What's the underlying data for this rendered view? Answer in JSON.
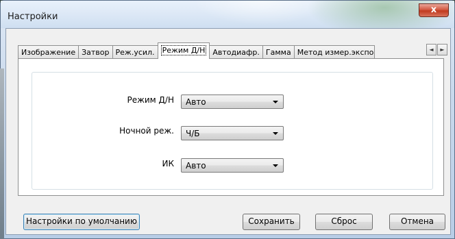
{
  "window": {
    "title": "Настройки",
    "close_symbol": "x"
  },
  "tabs": [
    {
      "label": "Изображение",
      "active": false
    },
    {
      "label": "Затвор",
      "active": false
    },
    {
      "label": "Реж.усил.",
      "active": false
    },
    {
      "label": "Режим Д/Н",
      "active": true
    },
    {
      "label": "Автодиафр.",
      "active": false
    },
    {
      "label": "Гамма",
      "active": false
    },
    {
      "label": "Метод измер.экспоз",
      "active": false
    }
  ],
  "tab_scroll": {
    "left": "◄",
    "right": "►"
  },
  "form": {
    "dn_mode": {
      "label": "Режим Д/Н",
      "value": "Авто"
    },
    "night_mode": {
      "label": "Ночной реж.",
      "value": "Ч/Б"
    },
    "ir": {
      "label": "ИК",
      "value": "Авто"
    }
  },
  "buttons": {
    "defaults": "Настройки по умолчанию",
    "save": "Сохранить",
    "reset": "Сброс",
    "cancel": "Отмена"
  },
  "icons": [
    "close-icon",
    "scroll-left-icon",
    "scroll-right-icon",
    "dropdown-arrow-icon"
  ]
}
